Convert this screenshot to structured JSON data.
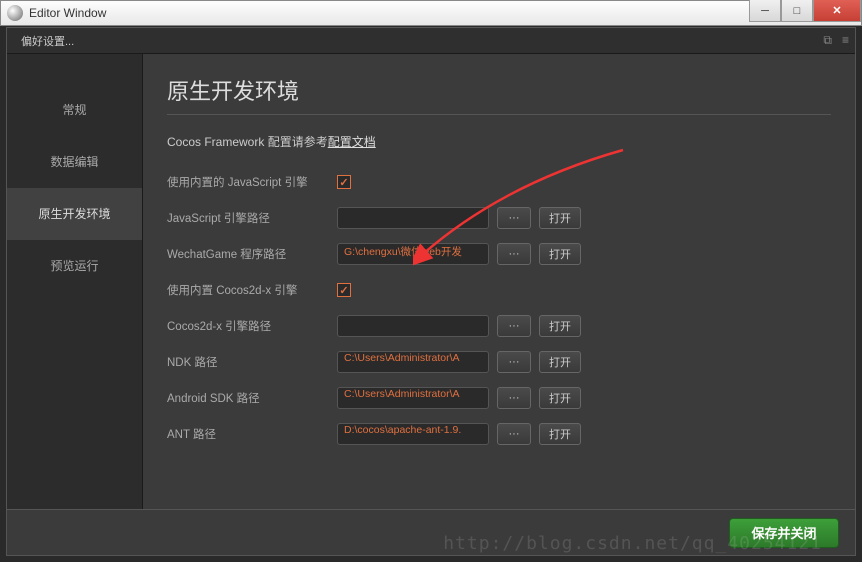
{
  "window": {
    "title": "Editor Window"
  },
  "tab": {
    "label": "偏好设置..."
  },
  "sidebar": {
    "items": [
      {
        "label": "常规"
      },
      {
        "label": "数据编辑"
      },
      {
        "label": "原生开发环境"
      },
      {
        "label": "预览运行"
      }
    ]
  },
  "main": {
    "title": "原生开发环境",
    "subtitle_prefix": "Cocos Framework 配置请参考",
    "subtitle_link": "配置文档",
    "rows": {
      "use_builtin_js": {
        "label": "使用内置的 JavaScript 引擎",
        "checked": true
      },
      "js_engine_path": {
        "label": "JavaScript 引擎路径",
        "value": "",
        "browse": "···",
        "open": "打开"
      },
      "wechat_path": {
        "label": "WechatGame 程序路径",
        "value": "G:\\chengxu\\微信web开发",
        "browse": "···",
        "open": "打开"
      },
      "use_builtin_cocos": {
        "label": "使用内置 Cocos2d-x 引擎",
        "checked": true
      },
      "cocos_path": {
        "label": "Cocos2d-x 引擎路径",
        "value": "",
        "browse": "···",
        "open": "打开"
      },
      "ndk_path": {
        "label": "NDK 路径",
        "value": "C:\\Users\\Administrator\\A",
        "browse": "···",
        "open": "打开"
      },
      "sdk_path": {
        "label": "Android SDK 路径",
        "value": "C:\\Users\\Administrator\\A",
        "browse": "···",
        "open": "打开"
      },
      "ant_path": {
        "label": "ANT 路径",
        "value": "D:\\cocos\\apache-ant-1.9.",
        "browse": "···",
        "open": "打开"
      }
    }
  },
  "footer": {
    "save_label": "保存并关闭"
  },
  "watermark": "http://blog.csdn.net/qq_40254121"
}
